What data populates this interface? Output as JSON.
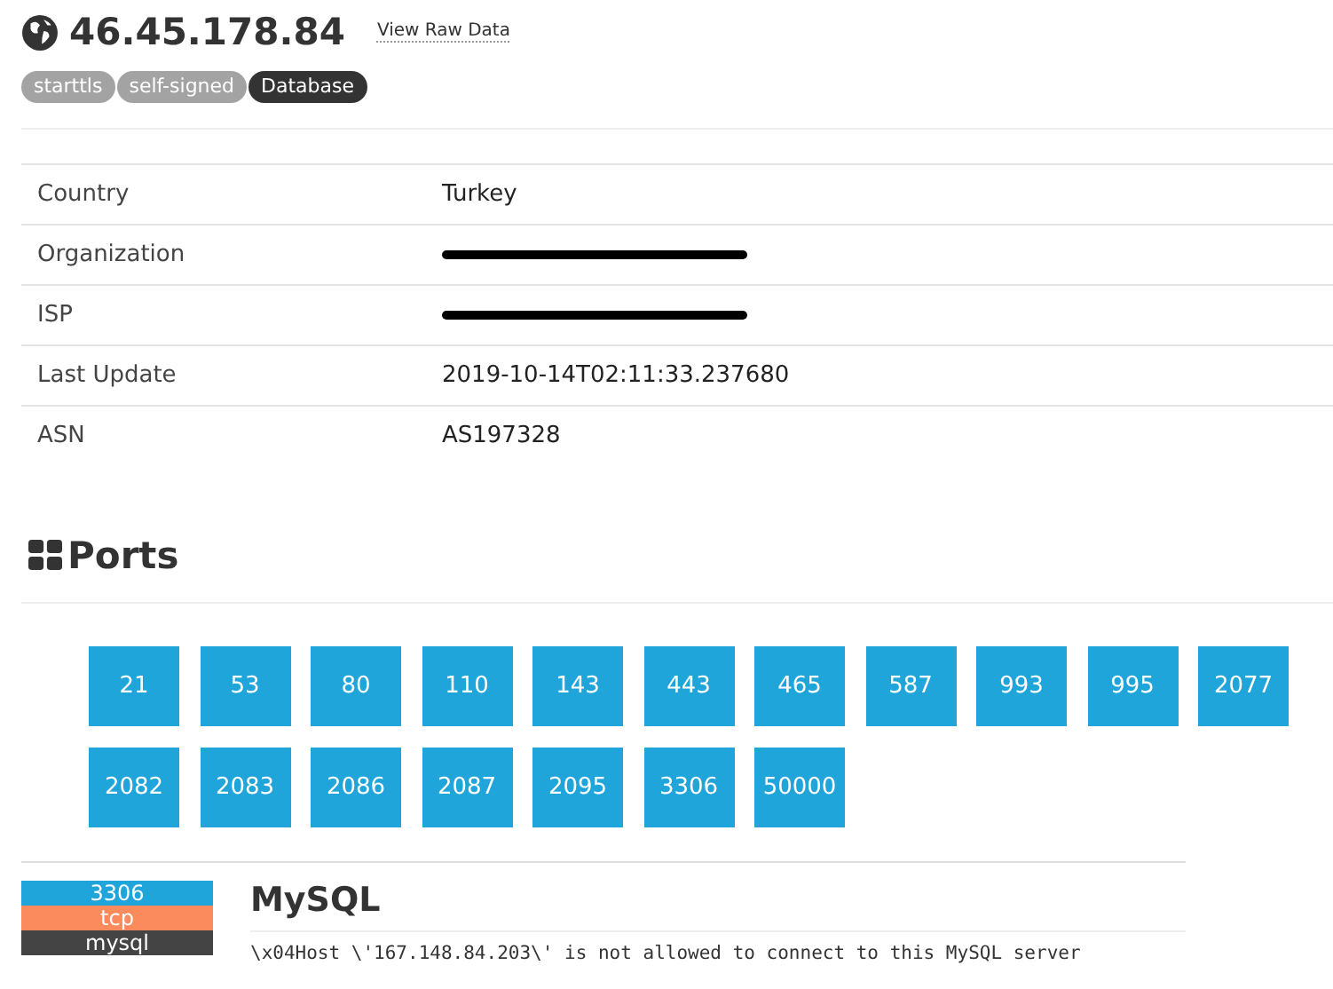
{
  "host": {
    "ip": "46.45.178.84",
    "raw_link": "View Raw Data"
  },
  "tags": [
    {
      "label": "starttls",
      "color": "#a3a3a3"
    },
    {
      "label": "self-signed",
      "color": "#a3a3a3"
    },
    {
      "label": "Database",
      "color": "#333333"
    }
  ],
  "details": [
    {
      "label": "Country",
      "value": "Turkey",
      "redacted": false
    },
    {
      "label": "Organization",
      "redacted": true
    },
    {
      "label": "ISP",
      "redacted": true
    },
    {
      "label": "Last Update",
      "value": "2019-10-14T02:11:33.237680",
      "redacted": false
    },
    {
      "label": "ASN",
      "value": "AS197328",
      "redacted": false
    }
  ],
  "ports_section": {
    "title": "Ports",
    "ports": [
      "21",
      "53",
      "80",
      "110",
      "143",
      "443",
      "465",
      "587",
      "993",
      "995",
      "2077",
      "2082",
      "2083",
      "2086",
      "2087",
      "2095",
      "3306",
      "50000"
    ]
  },
  "service": {
    "port": "3306",
    "transport": "tcp",
    "module": "mysql",
    "title": "MySQL",
    "banner": "\\x04Host \\'167.148.84.203\\' is not allowed to connect to this MySQL server"
  }
}
